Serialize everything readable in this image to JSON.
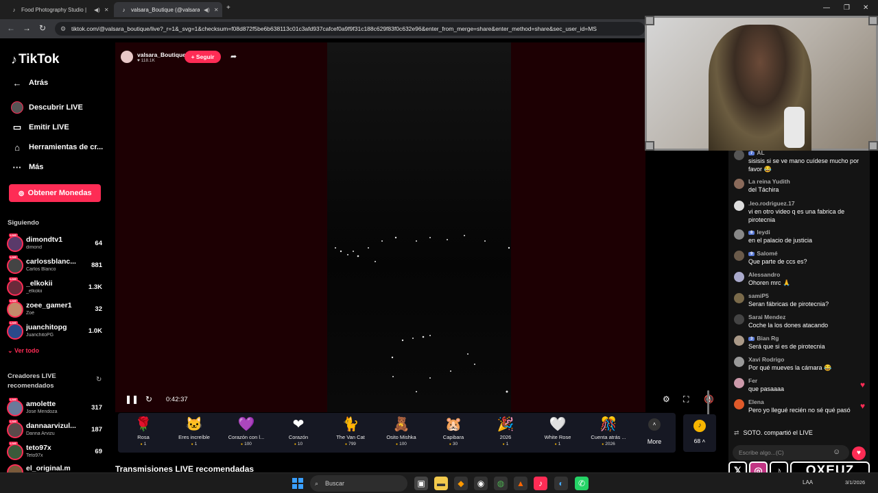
{
  "browser": {
    "tabs": [
      {
        "label": "Food Photography Studio |",
        "active": false
      },
      {
        "label": "valsara_Boutique (@valsara",
        "active": true
      }
    ],
    "new_tab": "+",
    "url": "tiktok.com/@valsara_boutique/live?_r=1&_svg=1&checksum=f08d872f5be6b638113c01c3afd937cafcef0a9f9f31c188c629f83f0c632e96&enter_from_merge=share&enter_method=share&sec_user_id=MS"
  },
  "sidebar": {
    "logo": "TikTok",
    "back": "Atrás",
    "nav": [
      {
        "label": "Descubrir LIVE",
        "icon": "discover-icon"
      },
      {
        "label": "Emitir LIVE",
        "icon": "camera-icon"
      },
      {
        "label": "Herramientas de cr...",
        "icon": "home-tools-icon"
      },
      {
        "label": "Más",
        "icon": "more-dots-icon"
      }
    ],
    "coins_button": "Obtener Monedas",
    "following_title": "Siguiendo",
    "following": [
      {
        "name": "dimondtv1",
        "sub": "dimond",
        "count": "64"
      },
      {
        "name": "carlossblanc...",
        "sub": "Carlos Blanco",
        "count": "881"
      },
      {
        "name": "_elkokii",
        "sub": "_elkokii",
        "count": "1.3K"
      },
      {
        "name": "zoee_gamer1",
        "sub": "Zoé",
        "count": "32"
      },
      {
        "name": "juanchitopg",
        "sub": "JuanchitoPG",
        "count": "1.0K"
      }
    ],
    "see_all": "Ver todo",
    "recommended_title": "Creadores LIVE recomendados",
    "recommended": [
      {
        "name": "amolette",
        "sub": "Jose Mendoza",
        "count": "317"
      },
      {
        "name": "dannaarvizul...",
        "sub": "Danna Arvizu",
        "count": "187"
      },
      {
        "name": "teto97x",
        "sub": "Teto97x",
        "count": "69"
      },
      {
        "name": "el_original.m",
        "sub": "",
        "count": ""
      }
    ],
    "live_badge": "LIVE"
  },
  "stream": {
    "host_name": "valsara_Boutique",
    "host_likes": "118.1K",
    "follow_label": "+ Seguir",
    "elapsed": "0:42:37",
    "volume_level": 0.15
  },
  "gifts": [
    {
      "name": "Rosa",
      "price": "1",
      "icon": "🌹"
    },
    {
      "name": "Eres increíble",
      "price": "1",
      "icon": "🐱"
    },
    {
      "name": "Corazón con l...",
      "price": "100",
      "icon": "💜"
    },
    {
      "name": "Corazón",
      "price": "10",
      "icon": "❤"
    },
    {
      "name": "The Van Cat",
      "price": "799",
      "icon": "🐈"
    },
    {
      "name": "Osito Mishka",
      "price": "100",
      "icon": "🧸"
    },
    {
      "name": "Capibara",
      "price": "30",
      "icon": "🐹"
    },
    {
      "name": "2026",
      "price": "1",
      "icon": "🎉"
    },
    {
      "name": "White Rose",
      "price": "1",
      "icon": "🤍"
    },
    {
      "name": "Cuenta atrás ...",
      "price": "2026",
      "icon": "🎊"
    }
  ],
  "more_label": "More",
  "coin_balance": "68",
  "recommended_section_title": "Transmisiones LIVE recomendadas",
  "chat": {
    "messages": [
      {
        "user": "AL",
        "badge": "7",
        "text": "sisisis si se ve mano cuídese mucho por favor 😂"
      },
      {
        "user": "La reina Yudith",
        "badge": "",
        "text": "del Táchira"
      },
      {
        "user": ".leo.rodriguez.17",
        "badge": "",
        "text": "vi en otro video q es una fabrica de pirotecnia"
      },
      {
        "user": "leydi",
        "badge": "8",
        "text": "en el palacio de justicia"
      },
      {
        "user": "Salomé",
        "badge": "9",
        "text": "Que parte de ccs es?"
      },
      {
        "user": "Alessandro",
        "badge": "",
        "text": "Ohoren mrc 🙏"
      },
      {
        "user": "samiP5",
        "badge": "",
        "text": "Seran fábricas de pirotecnia?"
      },
      {
        "user": "Sarai Mendez",
        "badge": "",
        "text": "Coche la los dones atacando"
      },
      {
        "user": "Bian Rg",
        "badge": "3",
        "text": "Será que si es de pirotecnia"
      },
      {
        "user": "Xavi Rodrigo",
        "badge": "",
        "text": "Por qué mueves la cámara 😂"
      },
      {
        "user": "Fer",
        "badge": "",
        "text": "que pasaaaa"
      },
      {
        "user": "Elena",
        "badge": "",
        "text": "Pero yo llegué recién no sé qué pasó"
      }
    ],
    "shared": "SOTO. compartió el LIVE",
    "input_placeholder": "Escribe algo...(C)"
  },
  "overlay": {
    "brand": "OXEUZ",
    "socials": [
      "X",
      "instagram",
      "tiktok"
    ]
  },
  "taskbar": {
    "search_label": "Buscar",
    "tray": "LAA",
    "date": "3/1/2026"
  }
}
